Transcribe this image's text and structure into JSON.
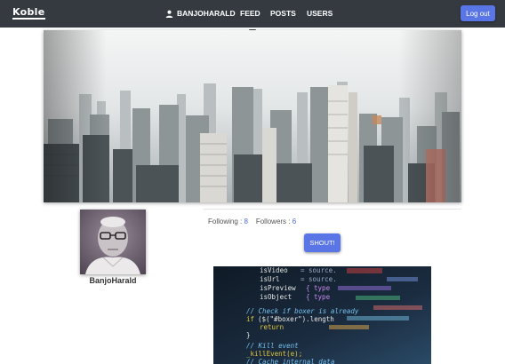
{
  "navbar": {
    "brand": "Koble",
    "user": {
      "icon": "user-icon",
      "label": "BANJOHARALD"
    },
    "links": [
      "FEED",
      "POSTS",
      "USERS"
    ],
    "logout_label": "Log out"
  },
  "profile": {
    "username": "BanjoHarald",
    "following_label": "Following :",
    "following_count": "8",
    "followers_label": "Followers :",
    "followers_count": "6",
    "shout_label": "SHOUT!"
  },
  "colors": {
    "navbar": "#343a40",
    "accent": "#5a75e5",
    "link_count": "#4b6bde"
  }
}
